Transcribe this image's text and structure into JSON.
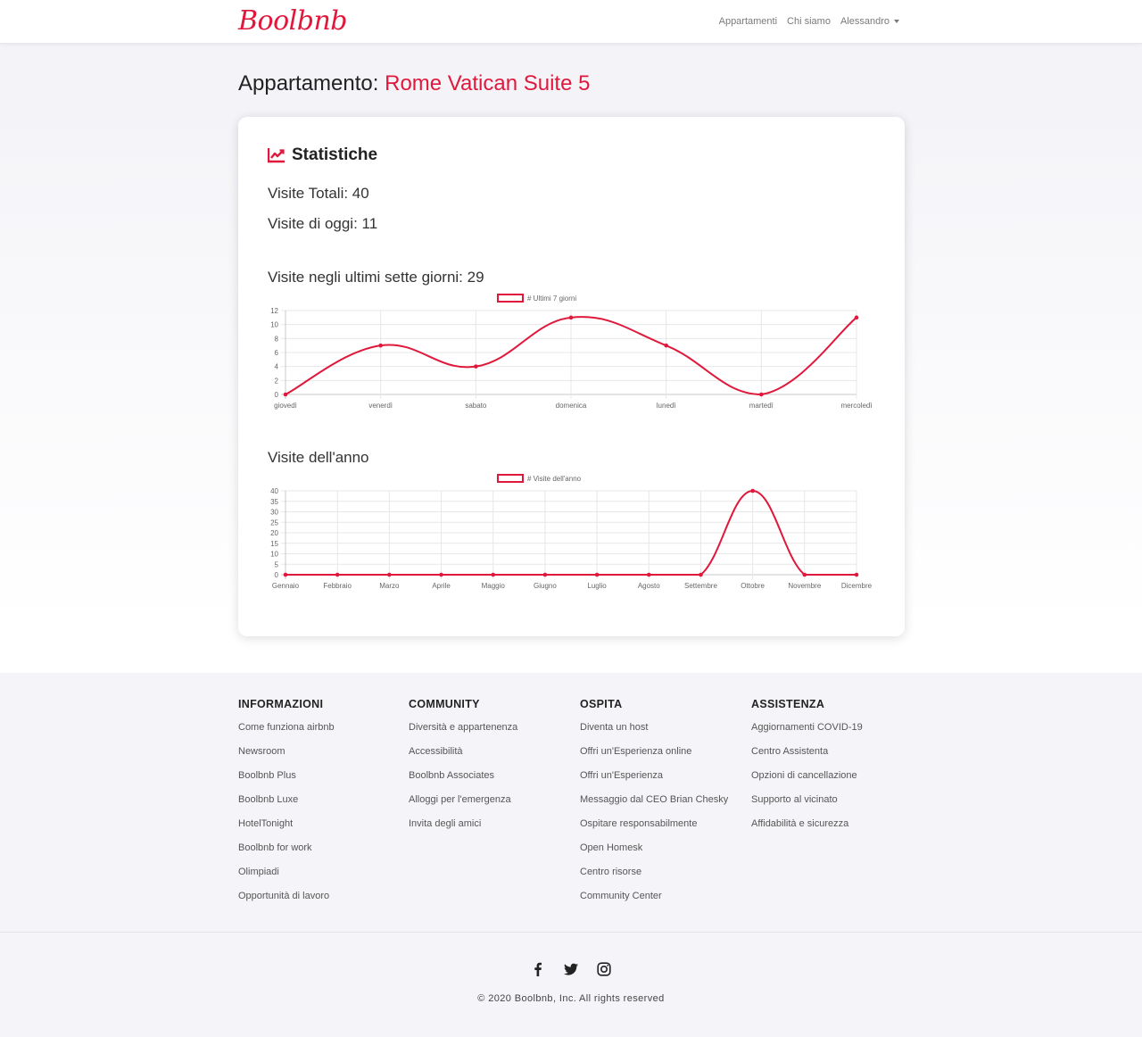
{
  "navbar": {
    "brand": "Boolbnb",
    "links": [
      "Appartamenti",
      "Chi siamo"
    ],
    "user": "Alessandro"
  },
  "page": {
    "title_prefix": "Appartamento:",
    "apartment_name": "Rome Vatican Suite 5"
  },
  "stats": {
    "heading": "Statistiche",
    "total_visits": "Visite Totali: 40",
    "today_visits": "Visite di oggi: 11"
  },
  "colors": {
    "accent": "#e0193c"
  },
  "chart_data": [
    {
      "type": "line",
      "title": "Visite negli ultimi sette giorni: 29",
      "categories": [
        "giovedì",
        "venerdì",
        "sabato",
        "domenica",
        "lunedì",
        "martedì",
        "mercoledì"
      ],
      "series": [
        {
          "name": "# Ultimi 7 giorni",
          "values": [
            0,
            7,
            4,
            11,
            7,
            0,
            11
          ]
        }
      ],
      "ylim": [
        0,
        12
      ],
      "yticks": [
        0,
        2,
        4,
        6,
        8,
        10,
        12
      ],
      "legend": "top-center",
      "grid": true
    },
    {
      "type": "line",
      "title": "Visite dell'anno",
      "categories": [
        "Gennaio",
        "Febbraio",
        "Marzo",
        "Aprile",
        "Maggio",
        "Giugno",
        "Luglio",
        "Agosto",
        "Settembre",
        "Ottobre",
        "Novembre",
        "Dicembre"
      ],
      "series": [
        {
          "name": "# Visite dell'anno",
          "values": [
            0,
            0,
            0,
            0,
            0,
            0,
            0,
            0,
            0,
            40,
            0,
            0
          ]
        }
      ],
      "ylim": [
        0,
        40
      ],
      "yticks": [
        0,
        5,
        10,
        15,
        20,
        25,
        30,
        35,
        40
      ],
      "legend": "top-center",
      "grid": true
    }
  ],
  "footer": {
    "columns": [
      {
        "title": "INFORMAZIONI",
        "links": [
          "Come funziona airbnb",
          "Newsroom",
          "Boolbnb Plus",
          "Boolbnb Luxe",
          "HotelTonight",
          "Boolbnb for work",
          "Olimpiadi",
          "Opportunità di lavoro"
        ]
      },
      {
        "title": "COMMUNITY",
        "links": [
          "Diversità e appartenenza",
          "Accessibilità",
          "Boolbnb Associates",
          "Alloggi per l'emergenza",
          "Invita degli amici"
        ]
      },
      {
        "title": "OSPITA",
        "links": [
          "Diventa un host",
          "Offri un'Esperienza online",
          "Offri un'Esperienza",
          "Messaggio dal CEO Brian Chesky",
          "Ospitare responsabilmente",
          "Open Homesk",
          "Centro risorse",
          "Community Center"
        ]
      },
      {
        "title": "ASSISTENZA",
        "links": [
          "Aggiornamenti COVID-19",
          "Centro Assistenta",
          "Opzioni di cancellazione",
          "Supporto al vicinato",
          "Affidabilità e sicurezza"
        ]
      }
    ],
    "socials": [
      "facebook-icon",
      "twitter-icon",
      "instagram-icon"
    ],
    "copyright": "© 2020 Boolbnb, Inc. All rights reserved"
  }
}
